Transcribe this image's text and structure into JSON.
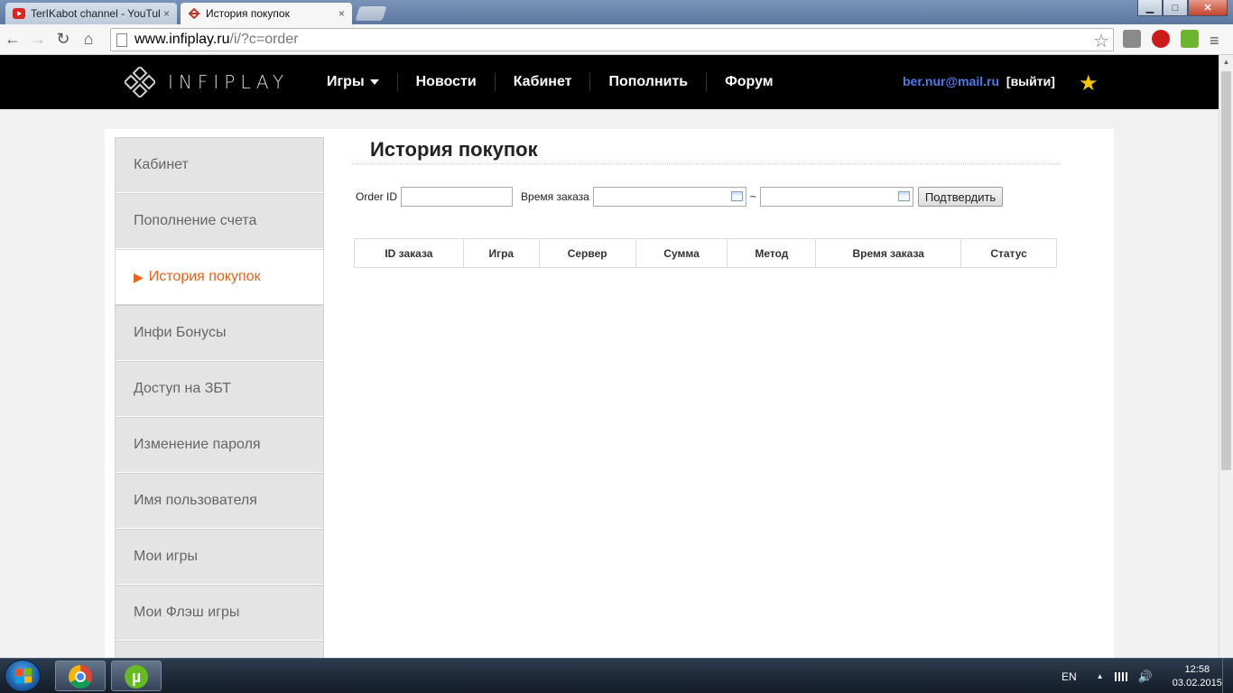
{
  "browser": {
    "tabs": [
      {
        "title": "TerIKabot channel - YouTube",
        "close": "×"
      },
      {
        "title": "История покупок",
        "close": "×"
      }
    ],
    "window_controls": {
      "minimize": "▁",
      "maximize": "□",
      "close": "✕"
    },
    "nav": {
      "back": "←",
      "forward": "→",
      "reload": "↻",
      "home": "⌂"
    },
    "url_host": "www.infiplay.ru",
    "url_path": "/i/?c=order",
    "bookmark_star": "☆",
    "menu": "≡"
  },
  "site": {
    "logo_text": "INFIPLAY",
    "nav_items": [
      "Игры",
      "Новости",
      "Кабинет",
      "Пополнить",
      "Форум"
    ],
    "user_email": "ber.nur@mail.ru",
    "logout_label": "[выйти]",
    "favorite_star": "★"
  },
  "sidebar": {
    "items": [
      {
        "label": "Кабинет",
        "active": false
      },
      {
        "label": "Пополнение счета",
        "active": false
      },
      {
        "label": "История покупок",
        "active": true
      },
      {
        "label": "Инфи Бонусы",
        "active": false
      },
      {
        "label": "Доступ на ЗБТ",
        "active": false
      },
      {
        "label": "Изменение пароля",
        "active": false
      },
      {
        "label": "Имя пользователя",
        "active": false
      },
      {
        "label": "Мои игры",
        "active": false
      },
      {
        "label": "Мои Флэш игры",
        "active": false
      }
    ],
    "active_marker": "▶"
  },
  "main": {
    "title": "История покупок",
    "filter": {
      "order_id_label": "Order ID",
      "order_id_value": "",
      "time_label": "Время заказа",
      "date_from": "",
      "separator": "~",
      "date_to": "",
      "submit_label": "Подтвердить"
    },
    "table": {
      "columns": [
        "ID заказа",
        "Игра",
        "Сервер",
        "Сумма",
        "Метод",
        "Время заказа",
        "Статус"
      ],
      "rows": []
    }
  },
  "taskbar": {
    "torrent_glyph": "µ",
    "language": "EN",
    "tray_up": "▲",
    "speaker": "🔊",
    "time": "12:58",
    "date": "03.02.2015"
  },
  "colors": {
    "header_bg": "#000000",
    "accent_orange": "#e8621a",
    "email_blue": "#4f7be8",
    "star_yellow": "#f6c600"
  }
}
